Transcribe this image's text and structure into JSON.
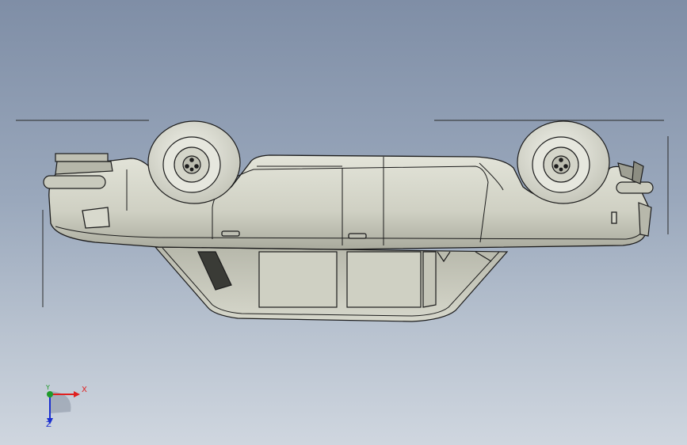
{
  "viewport": {
    "background_top": "#7f8ea6",
    "background_bottom": "#cfd6df"
  },
  "model": {
    "name_icon": "car-wireframe-model",
    "body_color": "#d2d3c6",
    "edge_color": "#1c1c1c",
    "wheel_color": "#e4e5dc"
  },
  "triad": {
    "x_label": "X",
    "y_label": "Y",
    "z_label": "Z",
    "x_color": "#e02020",
    "y_color": "#1f9a2a",
    "z_color": "#1a2fd0"
  }
}
